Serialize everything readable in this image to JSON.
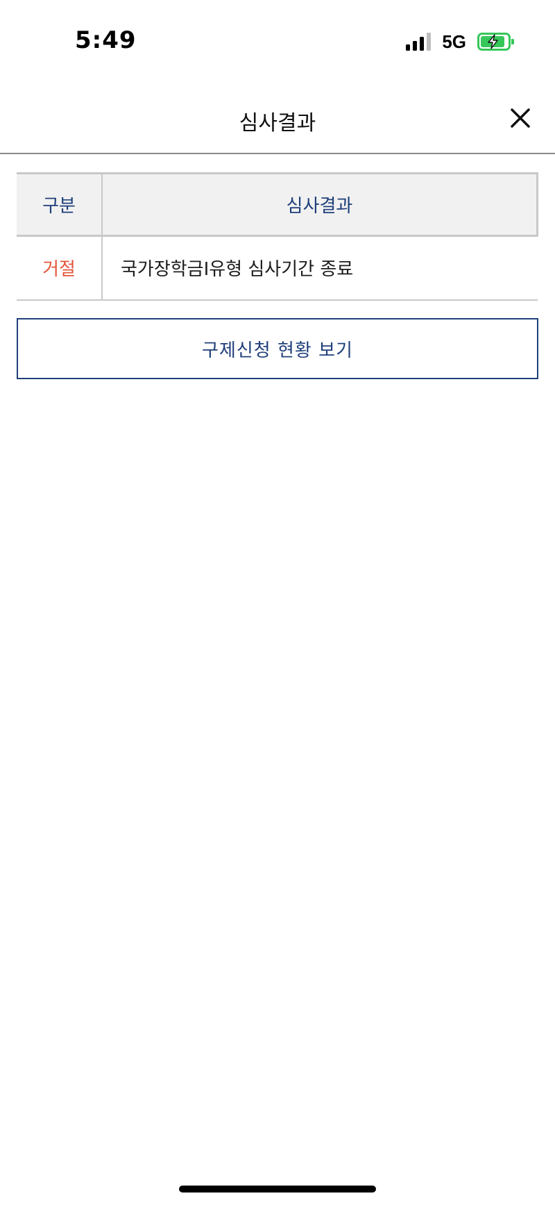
{
  "status_bar": {
    "time": "5:49",
    "network": "5G",
    "signal_bars": 4,
    "signal_active_bars": 3
  },
  "header": {
    "title": "심사결과",
    "close_icon": "close-icon"
  },
  "table": {
    "columns": [
      "구분",
      "심사결과"
    ],
    "rows": [
      {
        "type": "거절",
        "result": "국가장학금Ⅰ유형 심사기간 종료"
      }
    ]
  },
  "actions": {
    "relief_status_label": "구제신청 현황 보기"
  },
  "colors": {
    "accent_navy": "#1f3f7a",
    "reject_red": "#e4553a",
    "battery_green": "#35c759"
  }
}
